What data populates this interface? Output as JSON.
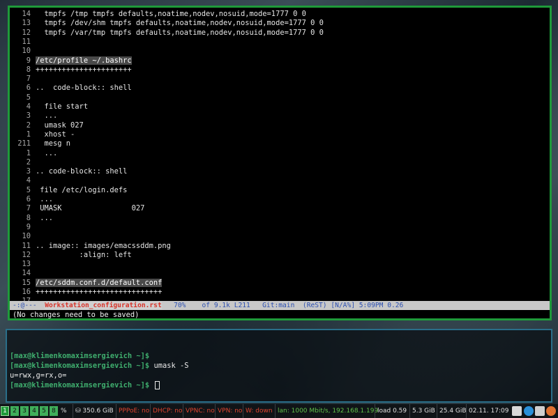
{
  "editor": {
    "lines": [
      {
        "ln": "14",
        "text": "  tmpfs /tmp tmpfs defaults,noatime,nodev,nosuid,mode=1777 0 0",
        "kind": "plain"
      },
      {
        "ln": "13",
        "text": "  tmpfs /dev/shm tmpfs defaults,noatime,nodev,nosuid,mode=1777 0 0",
        "kind": "plain"
      },
      {
        "ln": "12",
        "text": "  tmpfs /var/tmp tmpfs defaults,noatime,nodev,nosuid,mode=1777 0 0",
        "kind": "plain"
      },
      {
        "ln": "11",
        "text": "",
        "kind": "plain"
      },
      {
        "ln": "10",
        "text": "",
        "kind": "plain"
      },
      {
        "ln": "9",
        "text": "/etc/profile ~/.bashrc",
        "kind": "heading"
      },
      {
        "ln": "8",
        "text": "++++++++++++++++++++++",
        "kind": "plus"
      },
      {
        "ln": "7",
        "text": "",
        "kind": "plain"
      },
      {
        "ln": "6",
        "text": "..  code-block:: shell",
        "kind": "directive"
      },
      {
        "ln": "5",
        "text": "",
        "kind": "plain"
      },
      {
        "ln": "4",
        "text": "  file start",
        "kind": "plain"
      },
      {
        "ln": "3",
        "text": "  ...",
        "kind": "plain"
      },
      {
        "ln": "2",
        "text": "  umask 027",
        "kind": "plain"
      },
      {
        "ln": "1",
        "text": "  xhost -",
        "kind": "plain"
      },
      {
        "ln": "211",
        "text": "  mesg n",
        "kind": "plain"
      },
      {
        "ln": "1",
        "text": "  ...",
        "kind": "plain"
      },
      {
        "ln": "2",
        "text": "",
        "kind": "plain"
      },
      {
        "ln": "3",
        "text": ".. code-block:: shell",
        "kind": "directive"
      },
      {
        "ln": "4",
        "text": "",
        "kind": "plain"
      },
      {
        "ln": "5",
        "text": " file /etc/login.defs",
        "kind": "plain"
      },
      {
        "ln": "6",
        "text": " ...",
        "kind": "plain"
      },
      {
        "ln": "7",
        "text": " UMASK                027",
        "kind": "plain"
      },
      {
        "ln": "8",
        "text": " ...",
        "kind": "plain"
      },
      {
        "ln": "9",
        "text": "",
        "kind": "plain"
      },
      {
        "ln": "10",
        "text": "",
        "kind": "plain"
      },
      {
        "ln": "11",
        "text": ".. image:: images/emacssddm.png",
        "kind": "image"
      },
      {
        "ln": "12",
        "text": "          :align: left",
        "kind": "option"
      },
      {
        "ln": "13",
        "text": "",
        "kind": "plain"
      },
      {
        "ln": "14",
        "text": "",
        "kind": "plain"
      },
      {
        "ln": "15",
        "text": "/etc/sddm.conf.d/default.conf",
        "kind": "heading"
      },
      {
        "ln": "16",
        "text": "+++++++++++++++++++++++++++++",
        "kind": "plus"
      },
      {
        "ln": "17",
        "text": "",
        "kind": "plain"
      }
    ],
    "modeline": {
      "state": "-:@---",
      "filename": "Workstation_configuration.rst",
      "percent": "70%",
      "position": "of 9.1k L211",
      "branch": "Git:main",
      "mode": "(ReST) [N/A%] 5:09PM 0.26"
    },
    "minibuffer": "(No changes need to be saved)"
  },
  "terminal": {
    "lines": [
      {
        "prompt": "[max@klimenkomaximsergievich ~]$",
        "cmd": ""
      },
      {
        "prompt": "[max@klimenkomaximsergievich ~]$",
        "cmd": " umask -S"
      },
      {
        "prompt": "",
        "cmd": "u=rwx,g=rx,o="
      },
      {
        "prompt": "[max@klimenkomaximsergievich ~]$",
        "cmd": " "
      }
    ]
  },
  "statusbar": {
    "workspaces": [
      "1",
      "2",
      "3",
      "4",
      "5",
      "8"
    ],
    "active_workspace": "1",
    "percent_icon": "%",
    "disk": "350.6 GiB",
    "pppoe": "PPPoE: no",
    "dhcp": "DHCP: no",
    "vpnc": "VPNC: no",
    "vpn": "VPN: no",
    "wlan": "W: down",
    "lan": "lan: 1000 Mbit/s, 192.168.1.199",
    "load": "load 0.59",
    "mem": "5.3 GiB",
    "disk2": "25.4 GiB",
    "datetime": "02.11. 17:09",
    "colors": {
      "red": "#e0442f",
      "green": "#5fc24a"
    }
  }
}
